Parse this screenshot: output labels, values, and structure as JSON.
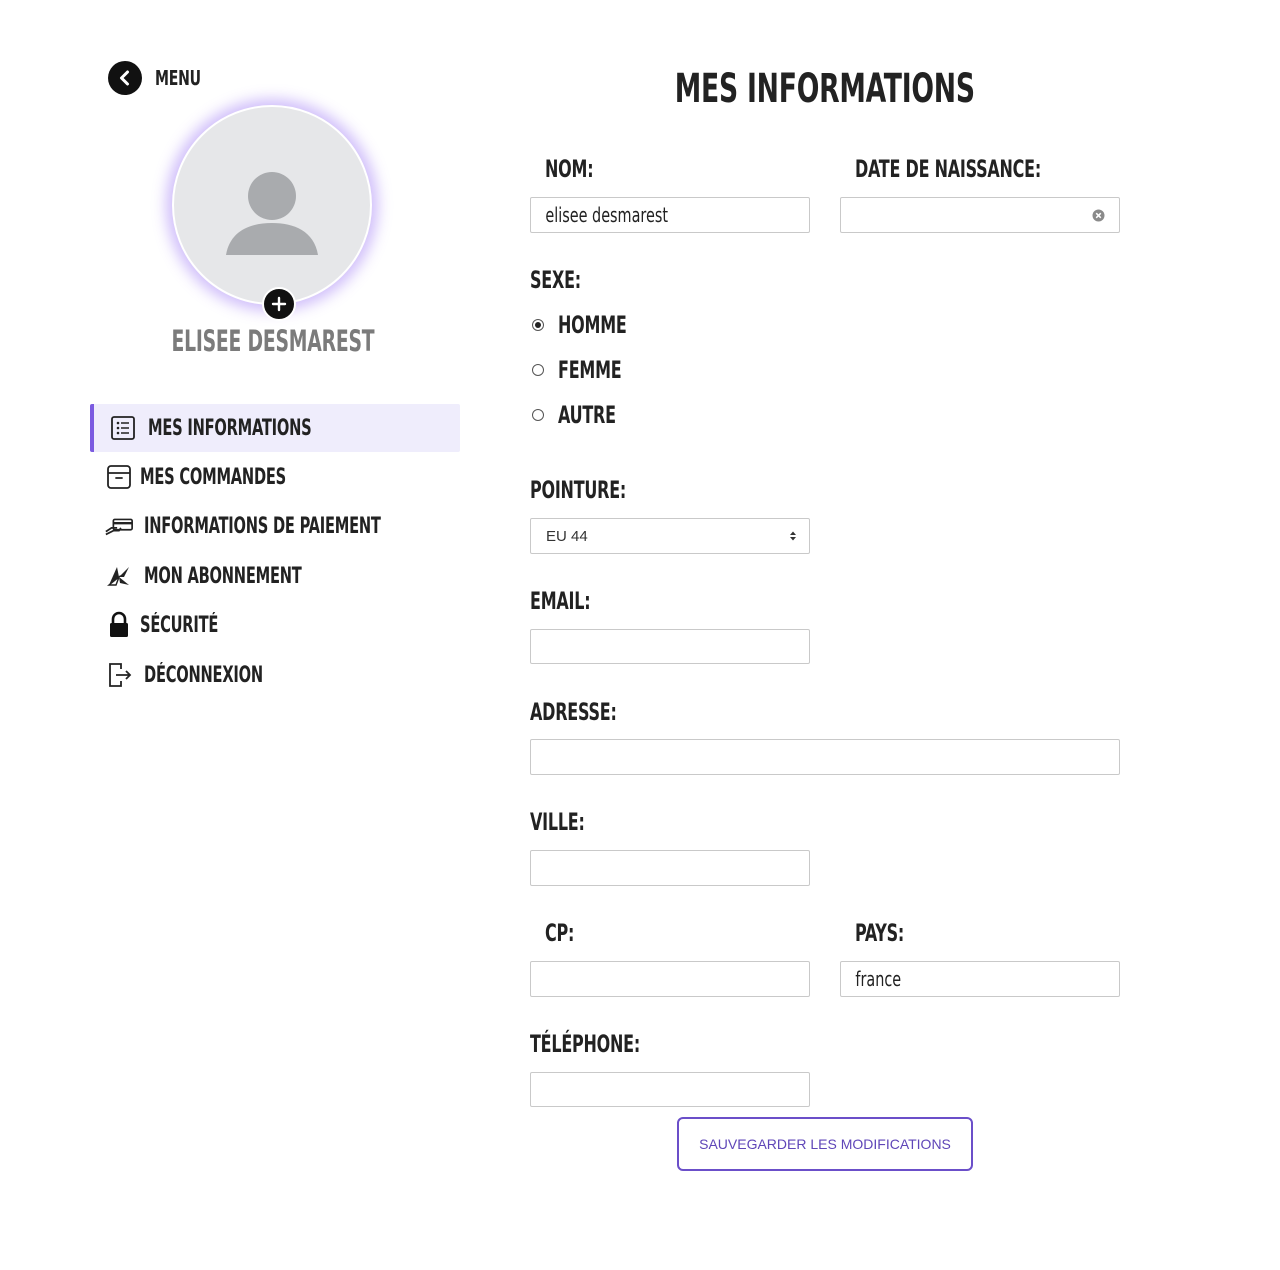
{
  "sidebar": {
    "menu_label": "MENU",
    "profile_name": "ELISEE DESMAREST",
    "items": [
      {
        "label": "MES INFORMATIONS",
        "icon": "list-icon",
        "active": true
      },
      {
        "label": "MES COMMANDES",
        "icon": "box-icon"
      },
      {
        "label": "INFORMATIONS DE PAIEMENT",
        "icon": "payment-card-icon"
      },
      {
        "label": "MON ABONNEMENT",
        "icon": "subscription-icon"
      },
      {
        "label": "SÉCURITÉ",
        "icon": "lock-icon"
      },
      {
        "label": "DÉCONNEXION",
        "icon": "logout-icon"
      }
    ]
  },
  "main": {
    "title": "MES INFORMATIONS",
    "nom": {
      "label": "NOM:",
      "value": "elisee desmarest"
    },
    "date_naissance": {
      "label": "DATE DE NAISSANCE:",
      "value": ""
    },
    "sexe": {
      "label": "SEXE:",
      "options": [
        "HOMME",
        "FEMME",
        "AUTRE"
      ],
      "selected": "HOMME"
    },
    "pointure": {
      "label": "POINTURE:",
      "value": "EU 44"
    },
    "email": {
      "label": "EMAIL:",
      "value": ""
    },
    "adresse": {
      "label": "ADRESSE:",
      "value": ""
    },
    "ville": {
      "label": "VILLE:",
      "value": ""
    },
    "cp": {
      "label": "CP:",
      "value": ""
    },
    "pays": {
      "label": "PAYS:",
      "value": "france"
    },
    "telephone": {
      "label": "TÉLÉPHONE:",
      "value": ""
    },
    "save_label": "SAUVEGARDER LES MODIFICATIONS"
  },
  "colors": {
    "accent": "#7b5be0",
    "active_bg": "#efedfc",
    "button_text": "#5f46b8"
  }
}
